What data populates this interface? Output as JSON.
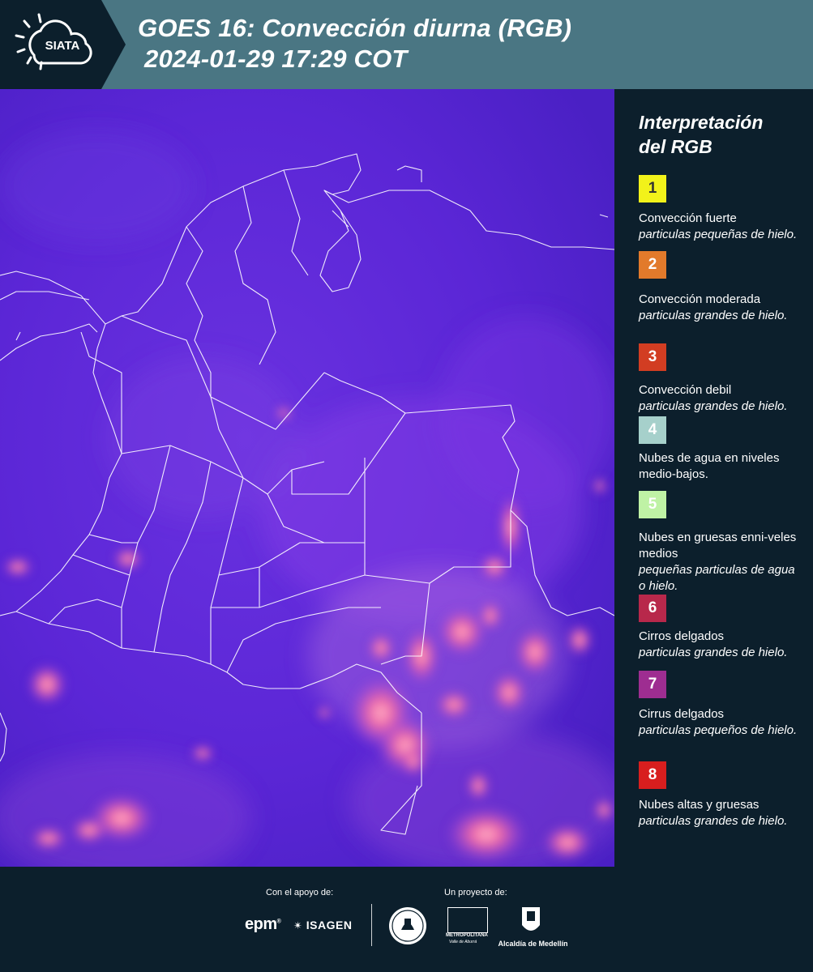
{
  "header": {
    "logo_text": "SIATA",
    "title_line1": "GOES 16: Convección diurna (RGB)",
    "title_line2": "2024-01-29 17:29 COT"
  },
  "legend": {
    "title_line1": "Interpretación",
    "title_line2": "del RGB",
    "items": [
      {
        "num": "1",
        "color": "#f2f21a",
        "num_color": "#333333",
        "name": "Convección fuerte",
        "desc": "particulas pequeñas de hielo."
      },
      {
        "num": "2",
        "color": "#e27a2b",
        "num_color": "#ffffff",
        "name": "Convección moderada",
        "desc": "particulas grandes de hielo."
      },
      {
        "num": "3",
        "color": "#d23d22",
        "num_color": "#ffffff",
        "name": "Convección debil",
        "desc": "particulas grandes de hielo."
      },
      {
        "num": "4",
        "color": "#a6d0cb",
        "num_color": "#ffffff",
        "name": "Nubes de agua en niveles medio-bajos.",
        "desc": ""
      },
      {
        "num": "5",
        "color": "#bff2a5",
        "num_color": "#ffffff",
        "name": "Nubes en gruesas enni-veles medios",
        "desc": "pequeñas particulas de agua o hielo."
      },
      {
        "num": "6",
        "color": "#b8284b",
        "num_color": "#ffffff",
        "name": "Cirros delgados",
        "desc": "particulas grandes de hielo."
      },
      {
        "num": "7",
        "color": "#9e2d91",
        "num_color": "#ffffff",
        "name": "Cirrus delgados",
        "desc": "particulas pequeños de hielo."
      },
      {
        "num": "8",
        "color": "#d81e1e",
        "num_color": "#ffffff",
        "name": "Nubes altas y gruesas",
        "desc": "particulas grandes de hielo."
      }
    ]
  },
  "footer": {
    "support_label": "Con el apoyo de:",
    "project_label": "Un proyecto de:",
    "epm": "epm",
    "isagen": "ISAGEN",
    "area_line1": "METROPOLITANA",
    "area_line2": "Valle de Aburrá",
    "alcaldia": "Alcaldía de Medellín"
  },
  "colors": {
    "header_bg": "#4a7683",
    "panel_bg": "#0c1f2c",
    "map_base": "#5a26d8",
    "convection_pink": "#f06aa8"
  }
}
